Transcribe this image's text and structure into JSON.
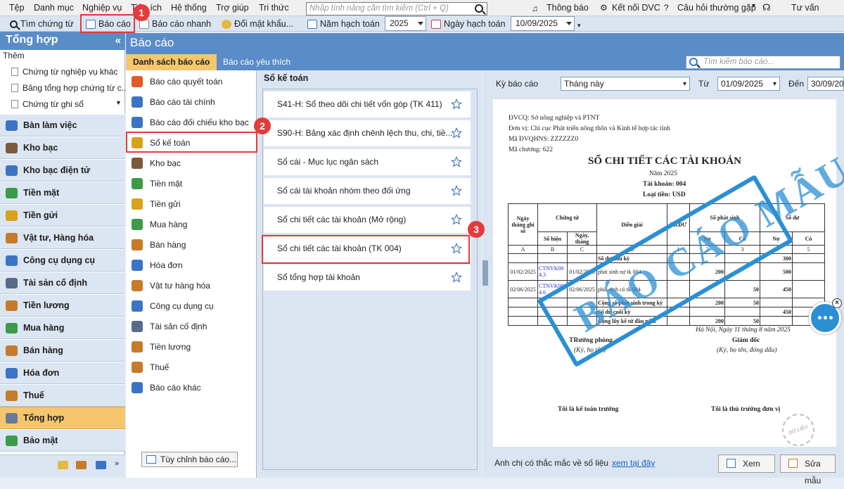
{
  "menu": {
    "items": [
      "Tệp",
      "Danh mục",
      "Nghiệp vụ",
      "Tiện ích",
      "Hệ thống",
      "Trợ giúp",
      "Tri thức"
    ],
    "search_placeholder": "Nhập tính năng cần tìm kiếm (Ctrl + Q)",
    "notifications": "Thông báo",
    "connect": "Kết nối DVC",
    "faq": "Câu hỏi thường gặp",
    "advisor": "Tư vấn"
  },
  "toolbar": {
    "find_voucher": "Tìm chứng từ",
    "report": "Báo cáo",
    "quick_report": "Báo cáo nhanh",
    "change_password": "Đổi mật khẩu...",
    "fiscal_year_label": "Năm hạch toán",
    "fiscal_year_value": "2025",
    "accounting_date_label": "Ngày hạch toán",
    "accounting_date_value": "10/09/2025"
  },
  "sidebar": {
    "title": "Tổng hợp",
    "group_label": "Thêm",
    "sub_items": [
      "Chứng từ nghiệp vụ khác",
      "Bảng tổng hợp chứng từ c...",
      "Chứng từ ghi sổ"
    ],
    "items": [
      {
        "label": "Bàn làm việc",
        "color": "#3b74c4"
      },
      {
        "label": "Kho bạc",
        "color": "#7a5a3a"
      },
      {
        "label": "Kho bạc điện tử",
        "color": "#3b74c4"
      },
      {
        "label": "Tiền mặt",
        "color": "#3c9a4a"
      },
      {
        "label": "Tiền gửi",
        "color": "#d9a21b"
      },
      {
        "label": "Vật tư, Hàng hóa",
        "color": "#c77a2a"
      },
      {
        "label": "Công cụ dụng cụ",
        "color": "#3b74c4"
      },
      {
        "label": "Tài sản cố định",
        "color": "#5a6a8a"
      },
      {
        "label": "Tiền lương",
        "color": "#c77a2a"
      },
      {
        "label": "Mua hàng",
        "color": "#3c9a4a"
      },
      {
        "label": "Bán hàng",
        "color": "#c77a2a"
      },
      {
        "label": "Hóa đơn",
        "color": "#3b74c4"
      },
      {
        "label": "Thuế",
        "color": "#c77a2a"
      },
      {
        "label": "Tổng hợp",
        "color": "#6a7a9a"
      },
      {
        "label": "Bảo mật",
        "color": "#3c9a4a"
      }
    ]
  },
  "content": {
    "title": "Báo cáo",
    "tabs": [
      "Danh sách báo cáo",
      "Báo cáo yêu thích"
    ],
    "search_placeholder": "Tìm kiếm báo cáo..."
  },
  "categories": [
    {
      "label": "Báo cáo quyết toán",
      "color": "#e05a2a"
    },
    {
      "label": "Báo cáo tài chính",
      "color": "#3b74c4"
    },
    {
      "label": "Báo cáo đối chiếu kho bạc",
      "color": "#3b74c4"
    },
    {
      "label": "Sổ kế toán",
      "color": "#d9a21b"
    },
    {
      "label": "Kho bạc",
      "color": "#7a5a3a"
    },
    {
      "label": "Tiền mặt",
      "color": "#3c9a4a"
    },
    {
      "label": "Tiền gửi",
      "color": "#d9a21b"
    },
    {
      "label": "Mua hàng",
      "color": "#3c9a4a"
    },
    {
      "label": "Bán hàng",
      "color": "#c77a2a"
    },
    {
      "label": "Hóa đơn",
      "color": "#3b74c4"
    },
    {
      "label": "Vật tư hàng hóa",
      "color": "#c77a2a"
    },
    {
      "label": "Công cụ dụng cụ",
      "color": "#3b74c4"
    },
    {
      "label": "Tài sản cố định",
      "color": "#5a6a8a"
    },
    {
      "label": "Tiền lương",
      "color": "#c77a2a"
    },
    {
      "label": "Thuế",
      "color": "#c77a2a"
    },
    {
      "label": "Báo cáo khác",
      "color": "#3b74c4"
    }
  ],
  "custom_report_button": "Tùy chỉnh báo cáo...",
  "report_list": {
    "title": "Sổ kế toán",
    "items": [
      "S41-H: Sổ theo dõi chi tiết vốn góp (TK 411)",
      "S90-H: Bảng xác định chênh lệch thu, chi, tiề...",
      "Sổ cái - Mục lục ngân sách",
      "Sổ cái tài khoản nhóm theo đối ứng",
      "Sổ chi tiết các tài khoản (Mở rộng)",
      "Sổ chi tiết các tài khoản (TK 004)",
      "Sổ tổng hợp tài khoản"
    ]
  },
  "preview": {
    "period_label": "Kỳ báo cáo",
    "period_value": "Tháng này",
    "from_label": "Từ",
    "from_value": "01/09/2025",
    "to_label": "Đến",
    "to_value": "30/09/20",
    "footer_text": "Anh chị có thắc mắc về số liệu",
    "footer_link": "xem tại đây",
    "view_button": "Xem",
    "edit_button": "Sửa mẫu"
  },
  "document": {
    "dvcq": "ĐVCQ: Sở nông nghiệp và PTNT",
    "unit": "Đơn vị: Chi cục Phát triển nông thôn và Kinh tế hợp tác tỉnh",
    "qhns": "Mã ĐVQHNS: ZZZZZZ0",
    "chapter": "Mã chương: 622",
    "title": "SỔ CHI TIẾT CÁC TÀI KHOẢN",
    "year": "Năm 2025",
    "account": "Tài khoản: 004",
    "currency": "Loại tiền: USD",
    "headers": {
      "date": "Ngày tháng ghi sổ",
      "voucher": "Chứng từ",
      "number": "Số hiệu",
      "voucher_date": "Ngày, tháng",
      "desc": "Diễn giải",
      "tkdu": "TKĐƯ",
      "arising": "Số phát sinh",
      "balance": "Số dư",
      "debit": "Nợ",
      "credit": "Có"
    },
    "letters": [
      "A",
      "B",
      "C",
      "D",
      "1",
      "2",
      "3",
      "4",
      "5"
    ],
    "rows": [
      {
        "date": "",
        "num": "",
        "vdate": "",
        "desc": "Số dư đầu kỳ",
        "tk": "",
        "dr": "",
        "cr": "",
        "bdr": "300",
        "bcr": ""
      },
      {
        "date": "01/02/2025",
        "num": "CTNVK00 4.3",
        "vdate": "01/02/2025",
        "desc": "phát sinh nợ tk 004",
        "tk": "",
        "dr": "200",
        "cr": "",
        "bdr": "500",
        "bcr": ""
      },
      {
        "date": "02/06/2025",
        "num": "CTNVK00 4.6",
        "vdate": "02/06/2025",
        "desc": "phát sinh có tk 004",
        "tk": "",
        "dr": "",
        "cr": "50",
        "bdr": "450",
        "bcr": ""
      },
      {
        "date": "",
        "num": "",
        "vdate": "",
        "desc": "Cộng số phát sinh trong kỳ",
        "tk": "",
        "dr": "200",
        "cr": "50",
        "bdr": "",
        "bcr": ""
      },
      {
        "date": "",
        "num": "",
        "vdate": "",
        "desc": "Số dư cuối kỳ",
        "tk": "",
        "dr": "",
        "cr": "",
        "bdr": "450",
        "bcr": ""
      },
      {
        "date": "",
        "num": "",
        "vdate": "",
        "desc": "Cộng lũy kế từ đầu năm",
        "tk": "",
        "dr": "200",
        "cr": "50",
        "bdr": "",
        "bcr": ""
      }
    ],
    "place_date": "Hà Nội, Ngày 11 tháng 8 năm 2025",
    "head_dept": "TRưởng phòng",
    "director": "Giám đốc",
    "sign_name": "(Ký, họ tên)",
    "sign_stamp": "(Ký, họ tên, đóng dấu)",
    "chief_accountant": "Tôi là kế toán trưởng",
    "head_unit": "Tôi là thủ trưởng đơn vị",
    "stamp": "BÁO CÁO MẪU",
    "watermark": "DỮ LIỆU MẪU"
  },
  "annotations": [
    "1",
    "2",
    "3"
  ]
}
